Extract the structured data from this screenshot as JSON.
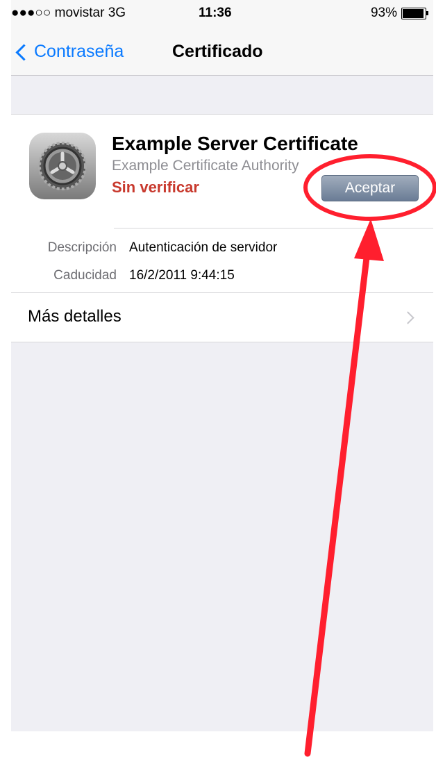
{
  "status": {
    "carrier": "●●●○○ movistar  3G",
    "time": "11:36",
    "battery": "93%",
    "battery_level": 0.93
  },
  "nav": {
    "back_label": "Contraseña",
    "title": "Certificado"
  },
  "certificate": {
    "icon": "gear-icon",
    "title": "Example Server Certificate",
    "issuer": "Example Certificate Authority",
    "status": "Sin verificar",
    "accept_label": "Aceptar",
    "details": [
      {
        "label": "Descripción",
        "value": "Autenticación de servidor"
      },
      {
        "label": "Caducidad",
        "value": "16/2/2011 9:44:15"
      }
    ],
    "more_details_label": "Más detalles"
  },
  "colors": {
    "accent": "#0a7aff",
    "unverified": "#c8392d",
    "annotation": "#ff1f2e"
  }
}
